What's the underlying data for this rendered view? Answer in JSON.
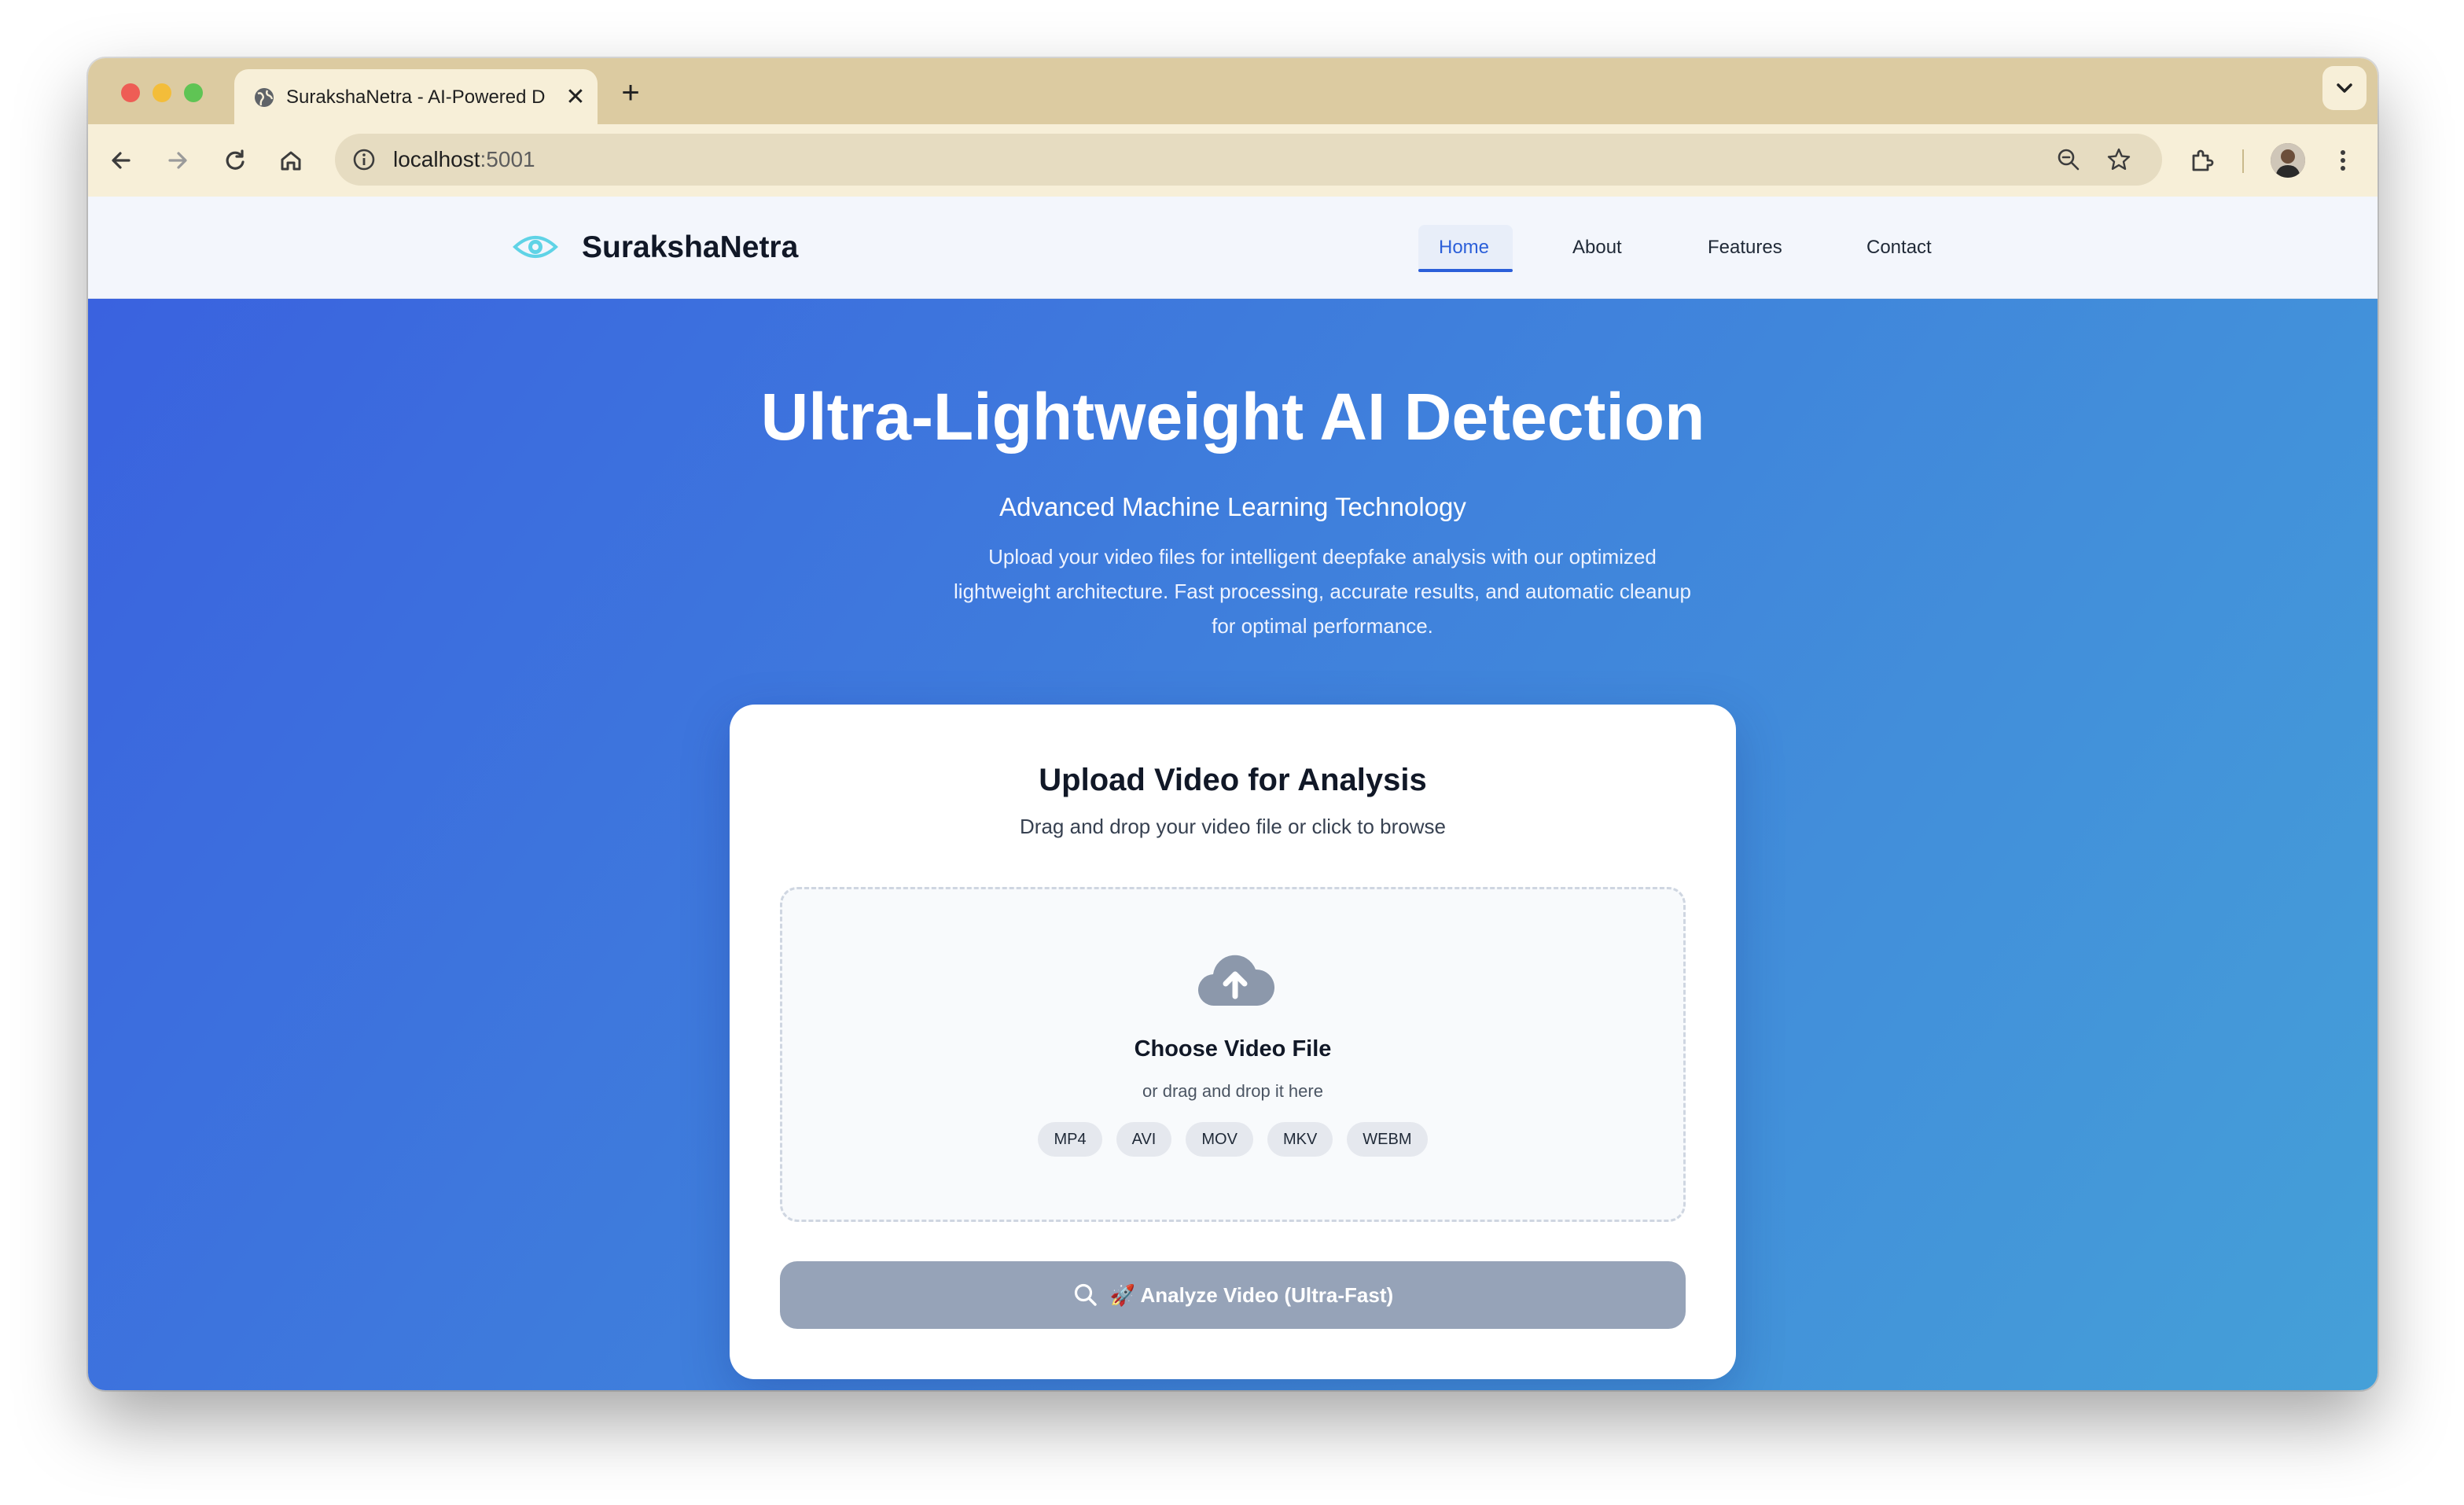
{
  "browser": {
    "tab_title": "SurakshaNetra - AI-Powered Deepfake Detection",
    "tab_close": "✕",
    "new_tab": "+",
    "url_host": "localhost",
    "url_port": ":5001"
  },
  "navbar": {
    "brand": "SurakshaNetra",
    "links": [
      {
        "label": "Home",
        "active": true
      },
      {
        "label": "About",
        "active": false
      },
      {
        "label": "Features",
        "active": false
      },
      {
        "label": "Contact",
        "active": false
      }
    ]
  },
  "hero": {
    "title": "Ultra-Lightweight AI Detection",
    "subtitle": "Advanced Machine Learning Technology",
    "description": "Upload your video files for intelligent deepfake analysis with our optimized lightweight architecture. Fast processing, accurate results, and automatic cleanup for optimal performance."
  },
  "upload_card": {
    "title": "Upload Video for Analysis",
    "subtitle": "Drag and drop your video file or click to browse",
    "dropzone_title": "Choose Video File",
    "dropzone_sub": "or drag and drop it here",
    "formats": [
      "MP4",
      "AVI",
      "MOV",
      "MKV",
      "WEBM"
    ],
    "analyze_label": "🚀 Analyze Video (Ultra-Fast)"
  },
  "colors": {
    "accent": "#2b5fd9",
    "hero_start": "#3a62df",
    "hero_end": "#45a0d8",
    "button_disabled": "#96a3b8",
    "brand_eye": "#5fd3e6"
  },
  "icons": [
    "globe-icon",
    "back-arrow-icon",
    "forward-arrow-icon",
    "reload-icon",
    "home-icon",
    "info-icon",
    "zoom-icon",
    "star-icon",
    "extensions-icon",
    "menu-dots-icon",
    "eye-icon",
    "cloud-upload-icon",
    "search-icon"
  ]
}
